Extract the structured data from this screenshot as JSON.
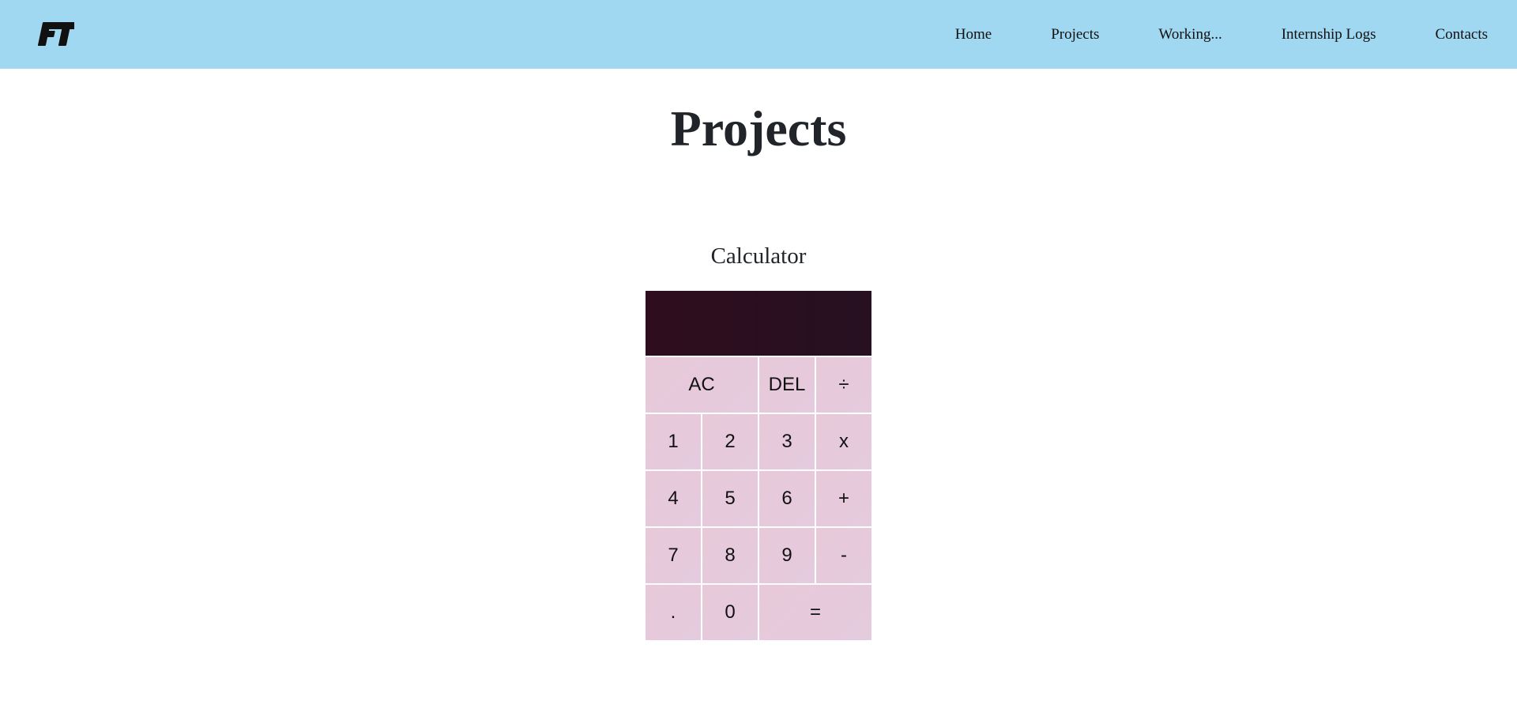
{
  "header": {
    "logo_text": "FT",
    "background_color": "#a0d8f1",
    "nav": [
      "Home",
      "Projects",
      "Working...",
      "Internship Logs",
      "Contacts"
    ]
  },
  "main": {
    "title": "Projects",
    "project": {
      "title": "Calculator",
      "display_value": "",
      "display_color": "#2f0d1e",
      "button_color": "#e8c9d9",
      "buttons": {
        "ac": "AC",
        "del": "DEL",
        "divide": "÷",
        "one": "1",
        "two": "2",
        "three": "3",
        "multiply": "x",
        "four": "4",
        "five": "5",
        "six": "6",
        "plus": "+",
        "seven": "7",
        "eight": "8",
        "nine": "9",
        "minus": "-",
        "decimal": ".",
        "zero": "0",
        "equals": "="
      }
    }
  }
}
